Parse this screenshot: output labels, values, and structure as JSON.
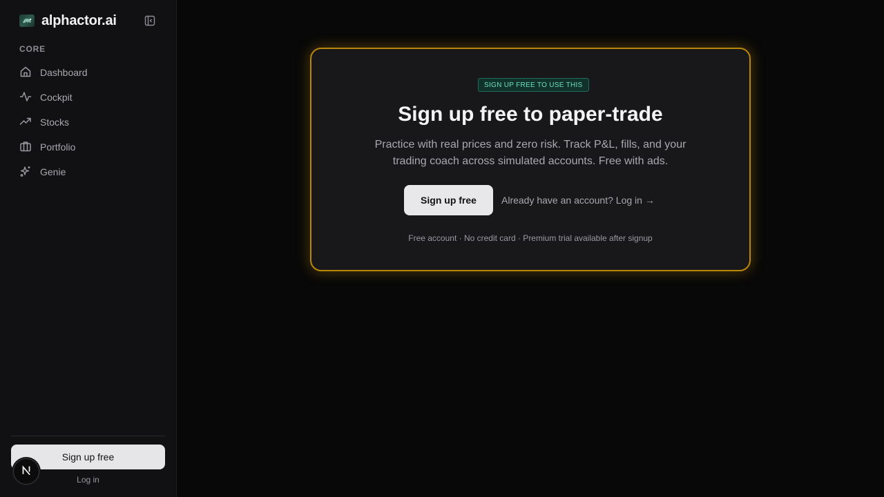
{
  "brand": {
    "name": "alphactor.ai",
    "logo_icon": "turtle-logo-icon"
  },
  "sidebar": {
    "section_label": "CORE",
    "items": [
      {
        "label": "Dashboard",
        "icon": "home-icon"
      },
      {
        "label": "Cockpit",
        "icon": "activity-icon"
      },
      {
        "label": "Stocks",
        "icon": "trending-up-icon"
      },
      {
        "label": "Portfolio",
        "icon": "briefcase-icon"
      },
      {
        "label": "Genie",
        "icon": "sparkles-icon"
      }
    ],
    "signup_label": "Sign up free",
    "login_label": "Log in",
    "dev_badge_letter": "N"
  },
  "card": {
    "badge": "SIGN UP FREE TO USE THIS",
    "title": "Sign up free to paper-trade",
    "description": "Practice with real prices and zero risk. Track P&L, fills, and your trading coach across simulated accounts. Free with ads.",
    "signup_label": "Sign up free",
    "login_link": "Already have an account? Log in →",
    "footnote": "Free account · No credit card · Premium trial available after signup"
  },
  "colors": {
    "background": "#080808",
    "sidebar": "#111113",
    "card": "#18181b",
    "card_border": "#b8860b",
    "badge_text": "#6fe0b9"
  }
}
